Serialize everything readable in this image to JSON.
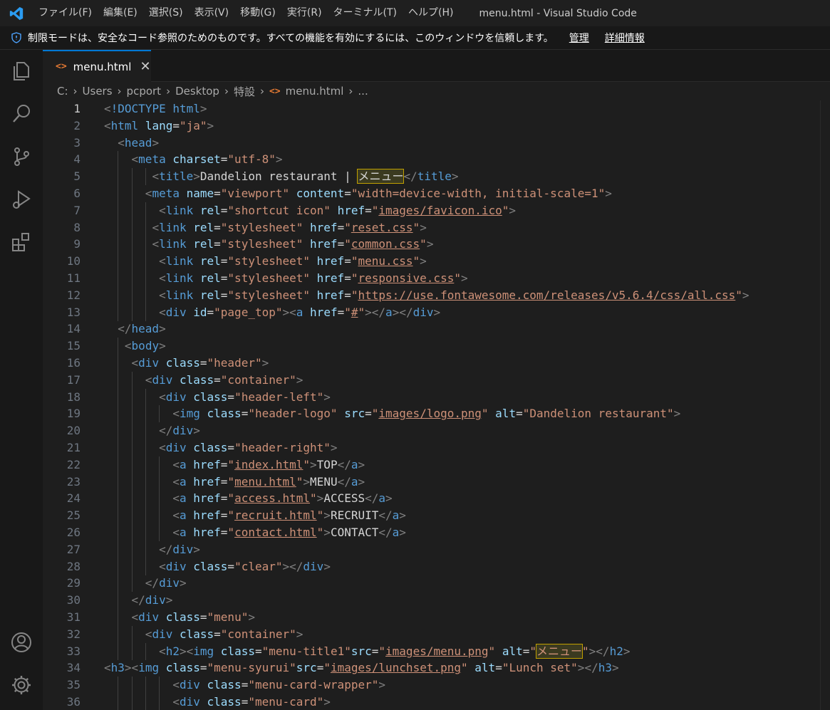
{
  "titlebar": {
    "menus": [
      "ファイル(F)",
      "編集(E)",
      "選択(S)",
      "表示(V)",
      "移動(G)",
      "実行(R)",
      "ターミナル(T)",
      "ヘルプ(H)"
    ],
    "window_title": "menu.html - Visual Studio Code"
  },
  "restricted_mode": {
    "message": "制限モードは、安全なコード参照のためのものです。すべての機能を有効にするには、このウィンドウを信頼します。",
    "manage_label": "管理",
    "details_label": "詳細情報"
  },
  "activity_bar": {
    "icons": [
      "explorer-icon",
      "search-icon",
      "source-control-icon",
      "run-debug-icon",
      "extensions-icon",
      "accounts-icon",
      "manage-gear-icon"
    ]
  },
  "tab": {
    "label": "menu.html",
    "close": "✕"
  },
  "breadcrumb": {
    "items": [
      "C:",
      "Users",
      "pcport",
      "Desktop",
      "特設",
      "menu.html",
      "..."
    ]
  },
  "editor": {
    "current_line": 1,
    "highlight_term": "メニュー",
    "lines": [
      "<!DOCTYPE html>",
      "<html lang=\"ja\">",
      "  <head>",
      "    <meta charset=\"utf-8\">",
      "       <title>Dandelion restaurant | メニュー</title>",
      "      <meta name=\"viewport\" content=\"width=device-width, initial-scale=1\">",
      "        <link rel=\"shortcut icon\" href=\"images/favicon.ico\">",
      "       <link rel=\"stylesheet\" href=\"reset.css\">",
      "       <link rel=\"stylesheet\" href=\"common.css\">",
      "        <link rel=\"stylesheet\" href=\"menu.css\">",
      "        <link rel=\"stylesheet\" href=\"responsive.css\">",
      "        <link rel=\"stylesheet\" href=\"https://use.fontawesome.com/releases/v5.6.4/css/all.css\">",
      "        <div id=\"page_top\"><a href=\"#\"></a></div>",
      "  </head>",
      "   <body>",
      "    <div class=\"header\">",
      "      <div class=\"container\">",
      "        <div class=\"header-left\">",
      "          <img class=\"header-logo\" src=\"images/logo.png\" alt=\"Dandelion restaurant\">",
      "        </div>",
      "        <div class=\"header-right\">",
      "          <a href=\"index.html\">TOP</a>",
      "          <a href=\"menu.html\">MENU</a>",
      "          <a href=\"access.html\">ACCESS</a>",
      "          <a href=\"recruit.html\">RECRUIT</a>",
      "          <a href=\"contact.html\">CONTACT</a>",
      "        </div>",
      "        <div class=\"clear\"></div>",
      "      </div>",
      "    </div>",
      "    <div class=\"menu\">",
      "      <div class=\"container\">",
      "        <h2><img class=\"menu-title1\"src=\"images/menu.png\" alt=\"メニュー\"></h2>",
      "<h3><img class=\"menu-syurui\"src=\"images/lunchset.png\" alt=\"Lunch set\"></h3>",
      "          <div class=\"menu-card-wrapper\">",
      "          <div class=\"menu-card\">"
    ]
  }
}
